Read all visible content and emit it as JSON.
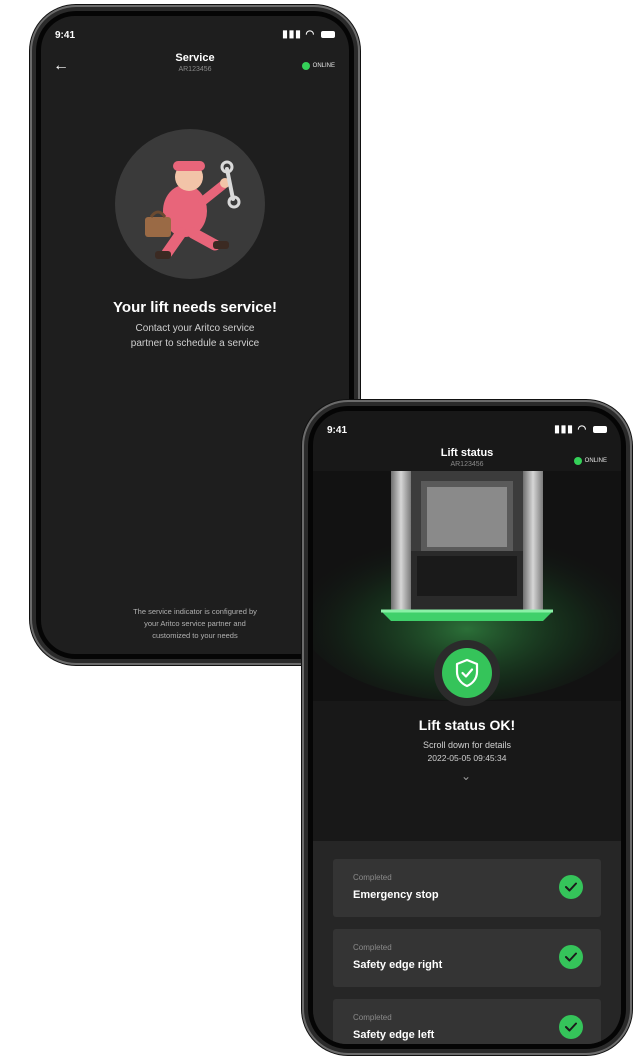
{
  "service_screen": {
    "status_bar": {
      "time": "9:41"
    },
    "nav": {
      "back_label": "←",
      "title": "Service",
      "subtitle": "AR123456",
      "online_label": "ONLINE"
    },
    "illustration": "mechanic-illustration",
    "heading": "Your lift needs service!",
    "body": "Contact your Aritco service\npartner to schedule a service",
    "footer": "The service indicator is configured by\nyour Aritco service partner and\ncustomized to your needs"
  },
  "lift_status_screen": {
    "status_bar": {
      "time": "9:41"
    },
    "nav": {
      "title": "Lift status",
      "subtitle": "AR123456",
      "online_label": "ONLINE"
    },
    "status_icon": "shield-check-icon",
    "heading": "Lift status OK!",
    "body": "Scroll down for details",
    "timestamp": "2022-05-05 09:45:34",
    "checks": [
      {
        "status": "Completed",
        "name": "Emergency stop"
      },
      {
        "status": "Completed",
        "name": "Safety edge right"
      },
      {
        "status": "Completed",
        "name": "Safety edge left"
      }
    ]
  },
  "colors": {
    "accent_green": "#35c45a",
    "screen_bg": "#1e1e1e",
    "online_dot": "#34d058"
  }
}
